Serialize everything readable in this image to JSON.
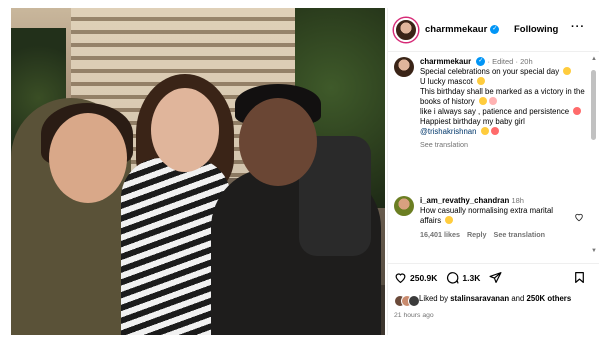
{
  "post": {
    "account": "charmmekaur",
    "follow_label": "Following",
    "more_label": "···"
  },
  "caption": {
    "username": "charmmekaur",
    "edited": "Edited",
    "age": "20h",
    "lines": [
      "Special celebrations on your special day",
      "U lucky mascot",
      "This birthday shall be marked as a victory in the books of history",
      "like i always say , patience and persistence",
      "Happiest birthday my baby girl"
    ],
    "mention": "@trishakrishnan",
    "see_translation": "See translation"
  },
  "comment": {
    "username": "i_am_revathy_chandran",
    "age": "18h",
    "text": "How casually normalising extra marital affairs",
    "likes": "16,401 likes",
    "reply_label": "Reply",
    "see_translation": "See translation"
  },
  "actions": {
    "like_count": "250.9K",
    "comment_count": "1.3K",
    "liked_by_prefix": "Liked by",
    "liked_by_user": "stalinsaravanan",
    "liked_by_and": "and",
    "liked_by_others": "250K others",
    "timestamp": "21 hours ago"
  },
  "icons": {
    "verified": "verified-badge-icon",
    "like": "heart-icon",
    "comment": "comment-bubble-icon",
    "share": "send-icon",
    "save": "bookmark-icon"
  },
  "colors": {
    "accent_blue": "#0095f6",
    "mention": "#00376b",
    "muted": "#737373"
  }
}
